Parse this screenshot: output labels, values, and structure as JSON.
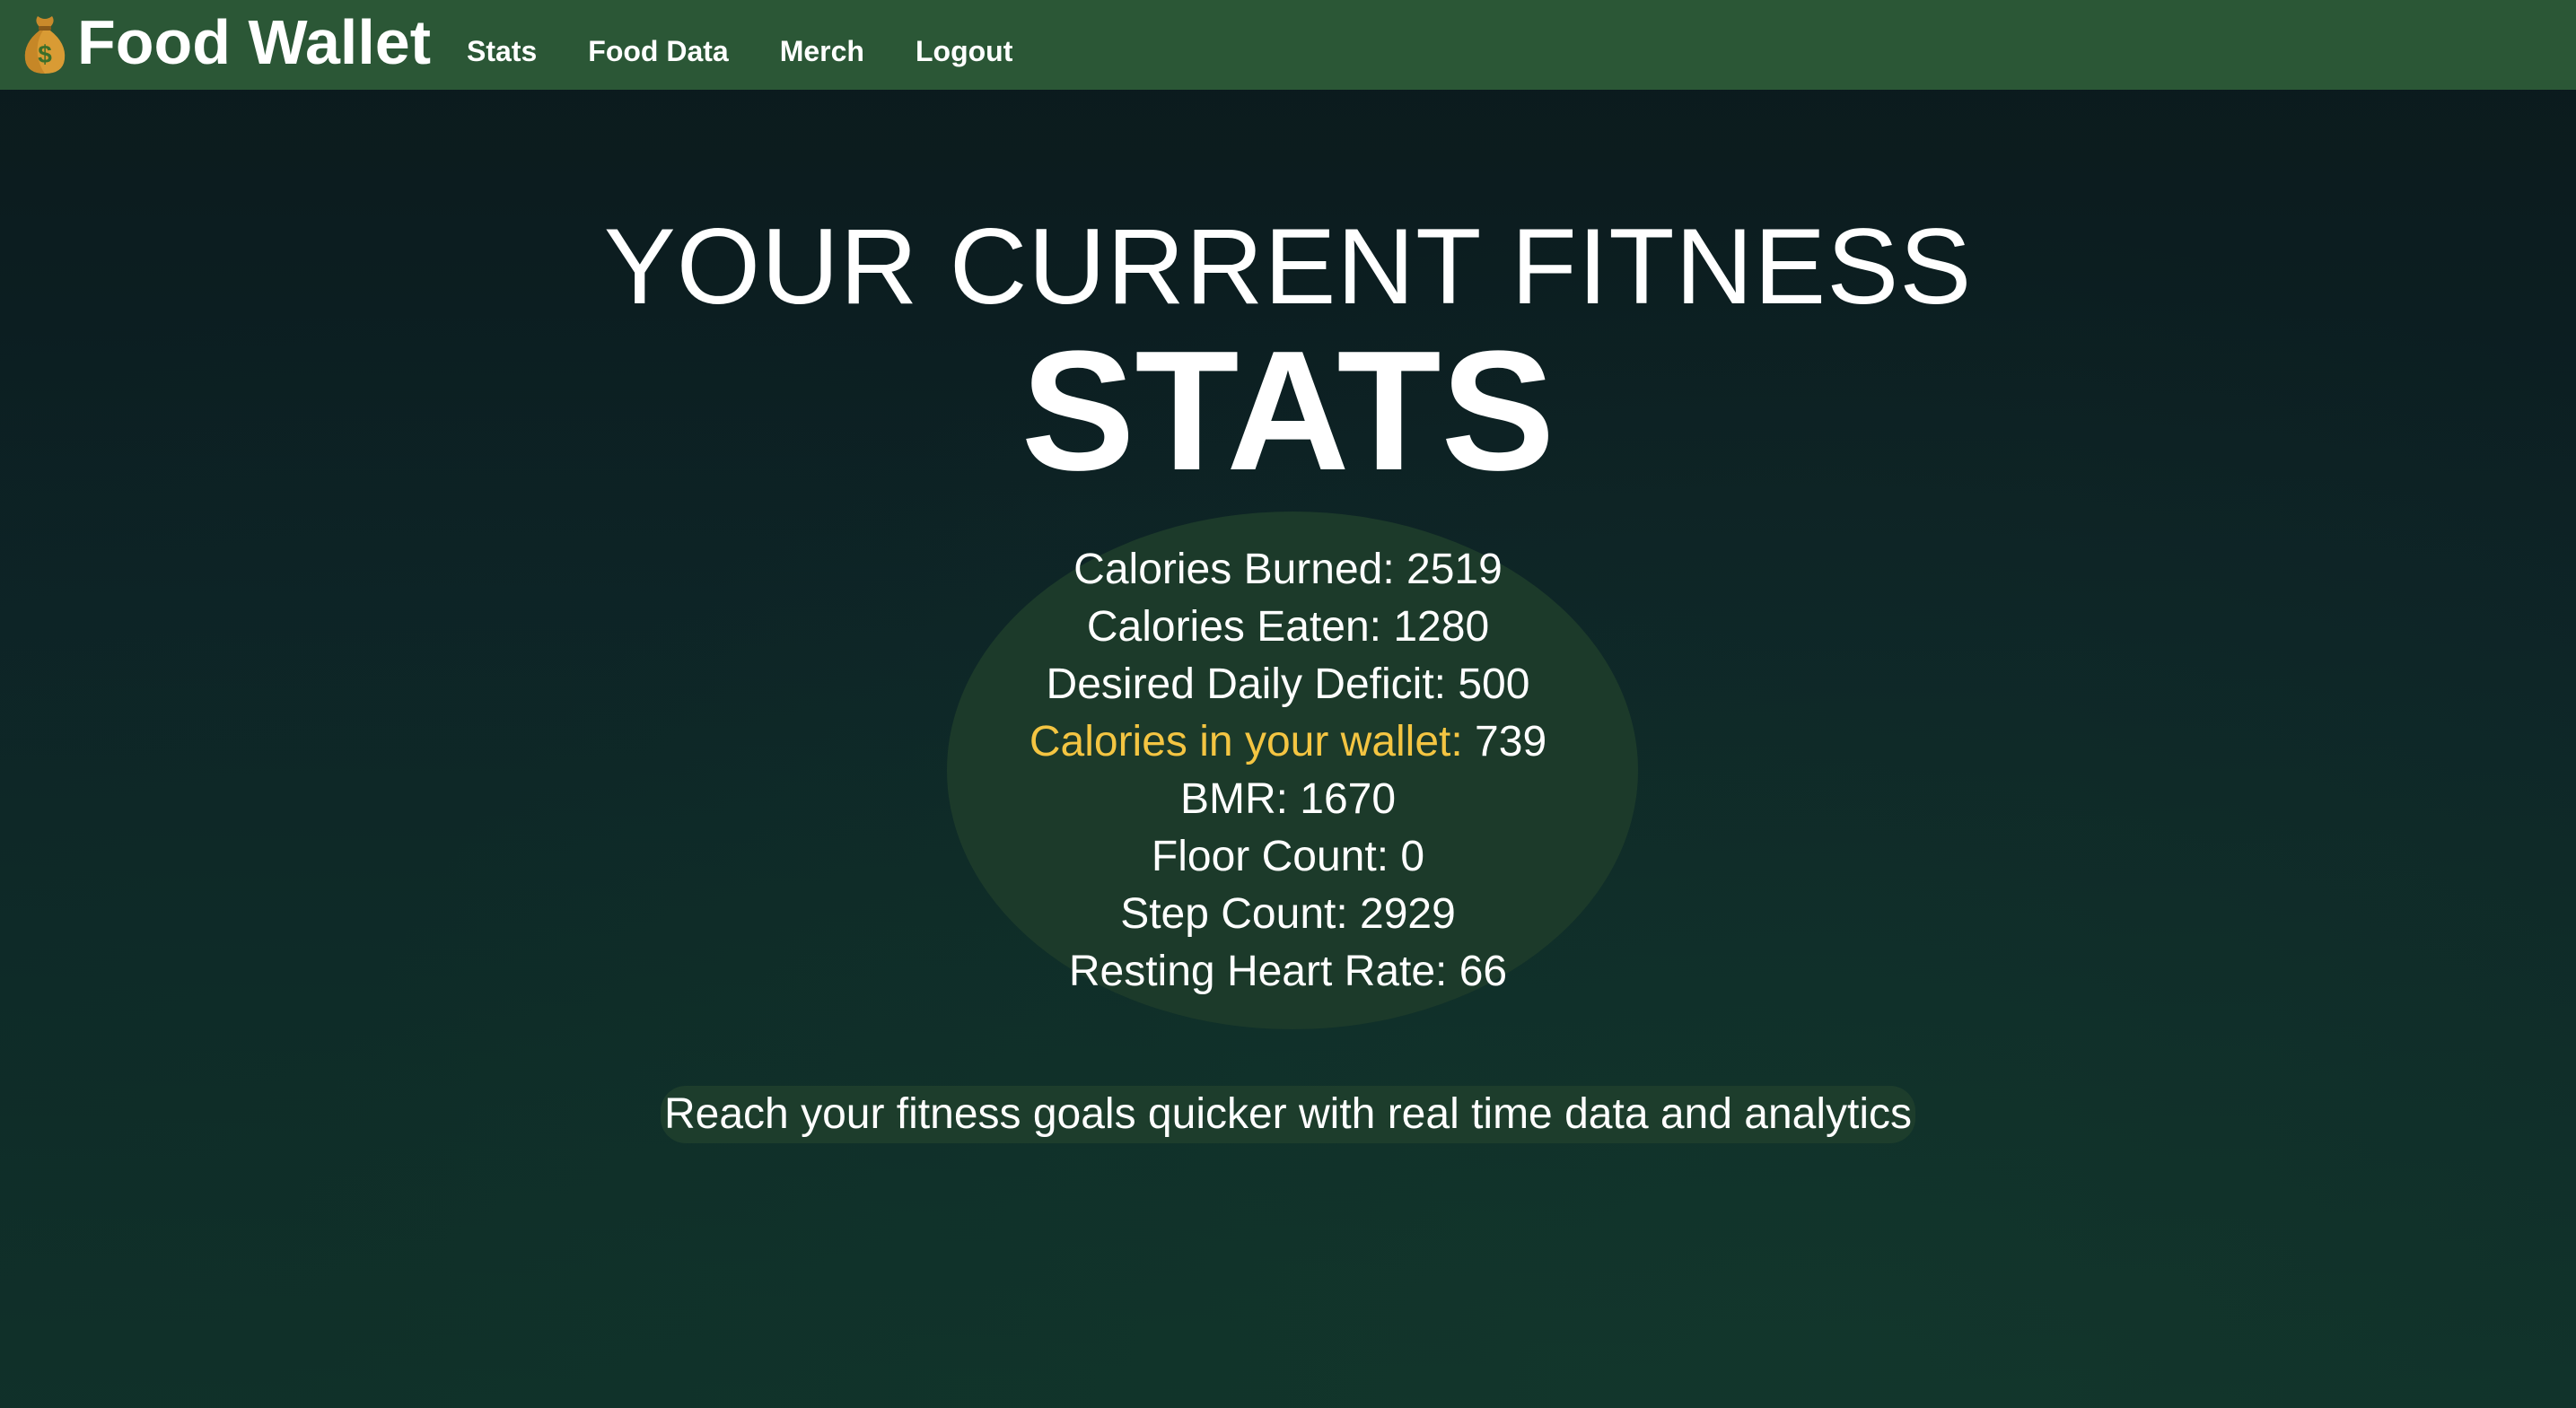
{
  "navbar": {
    "brand_icon": "money-bag-icon",
    "brand_name": "Food Wallet",
    "links": [
      "Stats",
      "Food Data",
      "Merch",
      "Logout"
    ]
  },
  "hero": {
    "line1": "YOUR CURRENT FITNESS",
    "line2": "STATS"
  },
  "stats": {
    "calories_burned": {
      "label": "Calories Burned:",
      "value": "2519"
    },
    "calories_eaten": {
      "label": "Calories Eaten:",
      "value": "1280"
    },
    "desired_deficit": {
      "label": "Desired Daily Deficit:",
      "value": "500"
    },
    "wallet": {
      "label": "Calories in your wallet:",
      "value": "739"
    },
    "bmr": {
      "label": "BMR:",
      "value": "1670"
    },
    "floor_count": {
      "label": "Floor Count:",
      "value": "0"
    },
    "step_count": {
      "label": "Step Count:",
      "value": "2929"
    },
    "resting_hr": {
      "label": "Resting Heart Rate:",
      "value": "66"
    }
  },
  "tagline": "Reach your fitness goals quicker with real time data and analytics",
  "colors": {
    "navbar": "#2b5736",
    "highlight": "#f4c542",
    "bubble": "#1c3a2a"
  }
}
